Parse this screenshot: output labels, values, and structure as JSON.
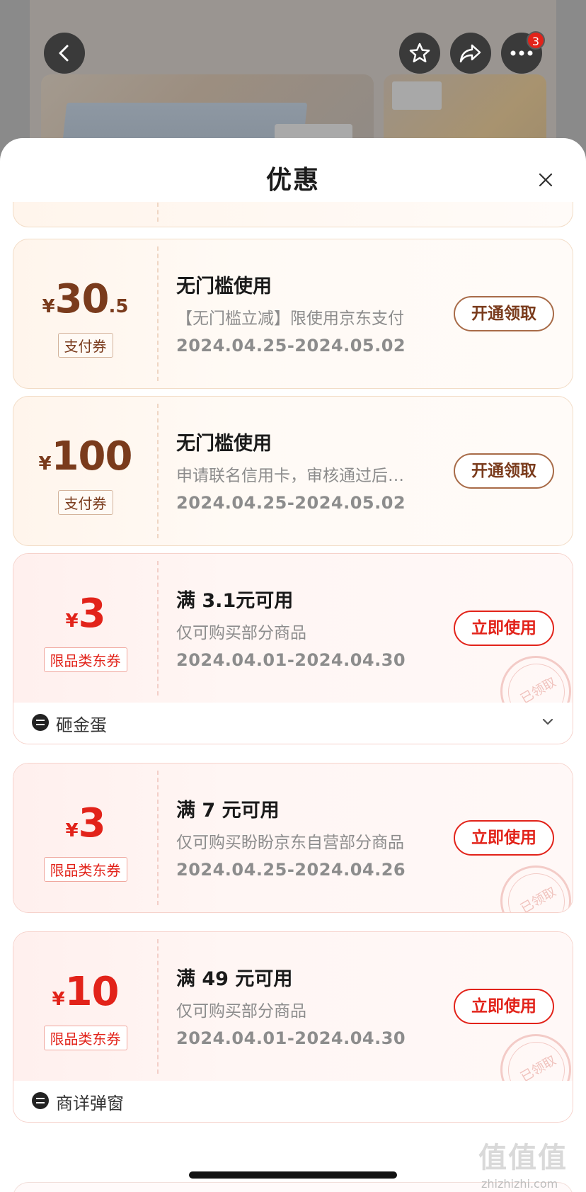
{
  "header": {
    "back_icon": "chevron-left-icon",
    "favorite_icon": "star-icon",
    "share_icon": "share-arrow-icon",
    "more_icon": "ellipsis-icon",
    "more_badge": "3"
  },
  "sheet": {
    "title": "优惠",
    "close_icon": "close-icon"
  },
  "coupons": [
    {
      "kind": "pay",
      "yen": "¥",
      "amount": "30",
      "amount_decimal": ".5",
      "tag": "支付券",
      "title": "无门槛使用",
      "desc": "【无门槛立减】限使用京东支付",
      "date": "2024.04.25-2024.05.02",
      "button": "开通领取"
    },
    {
      "kind": "pay",
      "yen": "¥",
      "amount": "100",
      "amount_decimal": "",
      "tag": "支付券",
      "title": "无门槛使用",
      "desc": "申请联名信用卡，审核通过后发放",
      "date": "2024.04.25-2024.05.02",
      "button": "开通领取"
    },
    {
      "kind": "jd",
      "yen": "¥",
      "amount": "3",
      "amount_decimal": "",
      "tag": "限品类东券",
      "title": "满 3.1元可用",
      "desc": "仅可购买部分商品",
      "date": "2024.04.01-2024.04.30",
      "button": "立即使用",
      "stamp": "已领取",
      "source": "砸金蛋"
    },
    {
      "kind": "jd",
      "yen": "¥",
      "amount": "3",
      "amount_decimal": "",
      "tag": "限品类东券",
      "title": "满 7 元可用",
      "desc": "仅可购买盼盼京东自营部分商品",
      "date": "2024.04.25-2024.04.26",
      "button": "立即使用",
      "stamp": "已领取"
    },
    {
      "kind": "jd",
      "yen": "¥",
      "amount": "10",
      "amount_decimal": "",
      "tag": "限品类东券",
      "title": "满 49 元可用",
      "desc": "仅可购买部分商品",
      "date": "2024.04.01-2024.04.30",
      "button": "立即使用",
      "stamp": "已领取",
      "source": "商详弹窗"
    }
  ],
  "watermark": {
    "text": "值值值",
    "site": "zhizhizhi.com"
  }
}
